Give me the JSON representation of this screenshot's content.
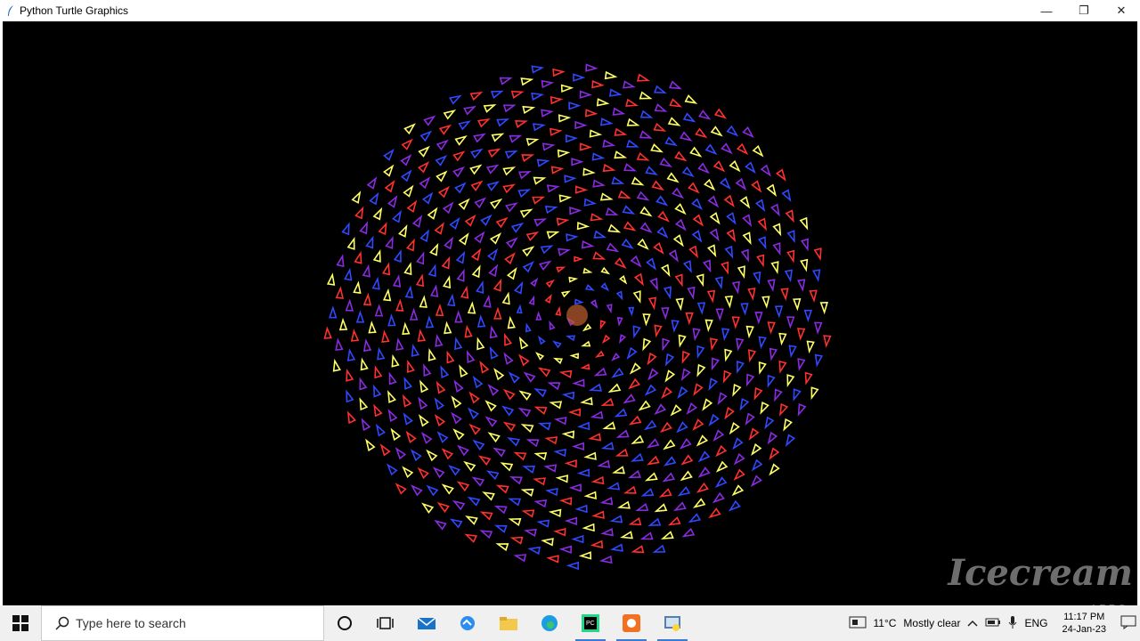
{
  "window": {
    "title": "Python Turtle Graphics",
    "minimize_glyph": "—",
    "restore_glyph": "❐",
    "close_glyph": "✕"
  },
  "canvas": {
    "background": "#000000",
    "colors": [
      "#ff3030",
      "#8a2be2",
      "#3048ff",
      "#ffff66"
    ],
    "pattern": "phyllotaxis spiral of small triangle turtles"
  },
  "taskbar": {
    "search_placeholder": "Type here to search",
    "weather_temp": "11°C",
    "weather_text": "Mostly clear",
    "language": "ENG",
    "time": "11:17 PM",
    "date": "24-Jan-23",
    "pinned_icons": [
      "cortana-icon",
      "task-view-icon",
      "mail-icon",
      "edge-legacy-icon",
      "file-explorer-icon",
      "edge-icon",
      "pycharm-icon",
      "app-orange-icon",
      "python-idle-icon"
    ]
  },
  "watermark": {
    "brand": "Icecream",
    "sub": "APPS"
  }
}
